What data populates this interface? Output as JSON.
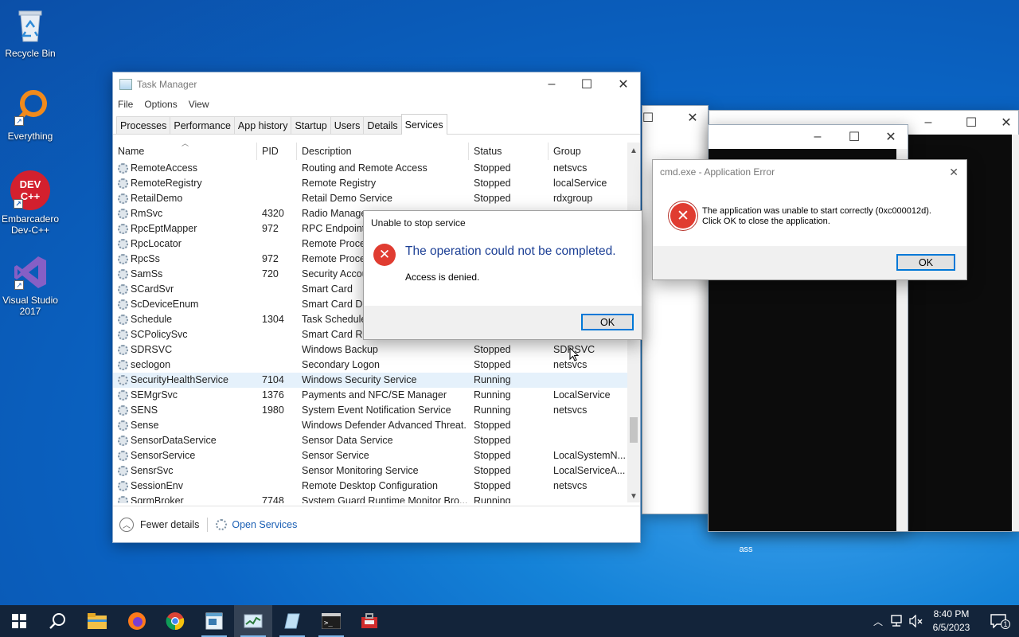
{
  "desktop": {
    "icons": [
      {
        "label": "Recycle Bin",
        "icon": "recycle-bin-icon"
      },
      {
        "label": "Everything",
        "icon": "everything-search-icon"
      },
      {
        "label": "Embarcadero Dev-C++",
        "icon": "devcpp-icon",
        "badge": "DEV C++"
      },
      {
        "label": "Visual Studio 2017",
        "icon": "visual-studio-icon"
      }
    ],
    "stray_label": "ass"
  },
  "task_manager": {
    "title": "Task Manager",
    "menu": [
      "File",
      "Options",
      "View"
    ],
    "tabs": [
      "Processes",
      "Performance",
      "App history",
      "Startup",
      "Users",
      "Details",
      "Services"
    ],
    "active_tab": "Services",
    "columns": [
      "Name",
      "PID",
      "Description",
      "Status",
      "Group"
    ],
    "rows": [
      [
        "RemoteAccess",
        "",
        "Routing and Remote Access",
        "Stopped",
        "netsvcs"
      ],
      [
        "RemoteRegistry",
        "",
        "Remote Registry",
        "Stopped",
        "localService"
      ],
      [
        "RetailDemo",
        "",
        "Retail Demo Service",
        "Stopped",
        "rdxgroup"
      ],
      [
        "RmSvc",
        "4320",
        "Radio Manager",
        "",
        ""
      ],
      [
        "RpcEptMapper",
        "972",
        "RPC Endpoint M",
        "",
        ""
      ],
      [
        "RpcLocator",
        "",
        "Remote Proced",
        "",
        ""
      ],
      [
        "RpcSs",
        "972",
        "Remote Proced",
        "",
        ""
      ],
      [
        "SamSs",
        "720",
        "Security Accou",
        "",
        ""
      ],
      [
        "SCardSvr",
        "",
        "Smart Card",
        "",
        ""
      ],
      [
        "ScDeviceEnum",
        "",
        "Smart Card De",
        "",
        ""
      ],
      [
        "Schedule",
        "1304",
        "Task Scheduler",
        "",
        ""
      ],
      [
        "SCPolicySvc",
        "",
        "Smart Card Rem",
        "",
        ""
      ],
      [
        "SDRSVC",
        "",
        "Windows Backup",
        "Stopped",
        "SDRSVC"
      ],
      [
        "seclogon",
        "",
        "Secondary Logon",
        "Stopped",
        "netsvcs"
      ],
      [
        "SecurityHealthService",
        "7104",
        "Windows Security Service",
        "Running",
        ""
      ],
      [
        "SEMgrSvc",
        "1376",
        "Payments and NFC/SE Manager",
        "Running",
        "LocalService"
      ],
      [
        "SENS",
        "1980",
        "System Event Notification Service",
        "Running",
        "netsvcs"
      ],
      [
        "Sense",
        "",
        "Windows Defender Advanced Threat...",
        "Stopped",
        ""
      ],
      [
        "SensorDataService",
        "",
        "Sensor Data Service",
        "Stopped",
        ""
      ],
      [
        "SensorService",
        "",
        "Sensor Service",
        "Stopped",
        "LocalSystemN..."
      ],
      [
        "SensrSvc",
        "",
        "Sensor Monitoring Service",
        "Stopped",
        "LocalServiceA..."
      ],
      [
        "SessionEnv",
        "",
        "Remote Desktop Configuration",
        "Stopped",
        "netsvcs"
      ],
      [
        "SgrmBroker",
        "7748",
        "System Guard Runtime Monitor Bro...",
        "Running",
        ""
      ]
    ],
    "selected_row": 14,
    "footer": {
      "fewer_details": "Fewer details",
      "open_services": "Open Services"
    }
  },
  "stop_dialog": {
    "title": "Unable to stop service",
    "heading": "The operation could not be completed.",
    "message": "Access is denied.",
    "ok": "OK",
    "heading_color": "#1c3f95"
  },
  "app_error": {
    "title": "cmd.exe - Application Error",
    "line1": "The application was unable to start correctly (0xc000012d).",
    "line2": "Click OK to close the application.",
    "ok": "OK"
  },
  "taskbar": {
    "apps": [
      "start-icon",
      "search-icon",
      "file-explorer-icon",
      "firefox-icon",
      "chrome-icon",
      "notepad-icon",
      "task-manager-icon",
      "sticky-app-icon",
      "cmd-icon",
      "toolbox-icon"
    ],
    "time": "8:40 PM",
    "date": "6/5/2023",
    "notification_count": "1"
  },
  "colors": {
    "accent": "#0078d7",
    "error_red": "#e03c31",
    "taskbar": "#13243a"
  }
}
